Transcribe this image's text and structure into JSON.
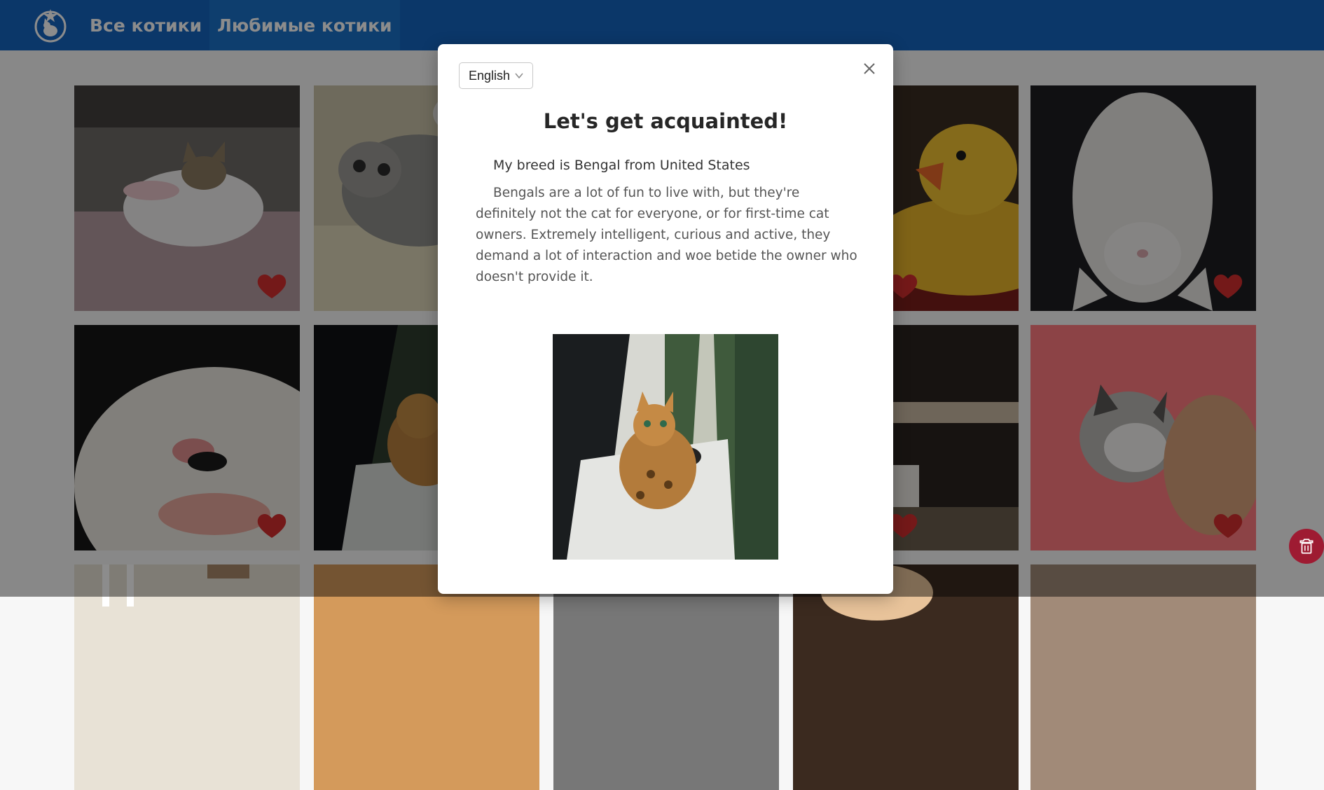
{
  "nav": {
    "logo_icon": "cat-star-logo-icon",
    "links": [
      {
        "label": "Все котики",
        "active": false
      },
      {
        "label": "Любимые котики",
        "active": true
      }
    ]
  },
  "grid": {
    "tiles": [
      {
        "subject": "white-rabbit-with-kitten",
        "favorite": true
      },
      {
        "subject": "grey-tabby-kitten-lying",
        "favorite": true
      },
      {
        "subject": "hidden-behind-modal",
        "favorite": true
      },
      {
        "subject": "cat-with-rubber-duck",
        "favorite": true
      },
      {
        "subject": "white-cat-upside-down",
        "favorite": true
      },
      {
        "subject": "white-cat-closeup-mouth",
        "favorite": true
      },
      {
        "subject": "bengal-cat-in-car-window",
        "favorite": true
      },
      {
        "subject": "hidden-behind-modal",
        "favorite": true
      },
      {
        "subject": "cat-in-kitchen",
        "favorite": true
      },
      {
        "subject": "kitten-held-in-hand",
        "favorite": true
      }
    ],
    "heart_color": "#d32f2f"
  },
  "fab": {
    "icon": "trash-icon",
    "color": "#9e1b32"
  },
  "modal": {
    "language_select": {
      "selected": "English",
      "icon": "chevron-down-icon"
    },
    "close_icon": "close-icon",
    "title": "Let's get acquainted!",
    "breed_line": "My breed is Bengal from United States",
    "description": "Bengals are a lot of fun to live with, but they're definitely not the cat for everyone, or for first-time cat owners. Extremely intelligent, curious and active, they demand a lot of interaction and woe betide the owner who doesn't provide it.",
    "photo_subject": "bengal-cat-looking-out-car-window"
  },
  "colors": {
    "navbar": "#1565c0",
    "nav_active": "#1a72c8",
    "overlay": "rgba(0,0,0,0.45)",
    "modal_bg": "#ffffff"
  }
}
